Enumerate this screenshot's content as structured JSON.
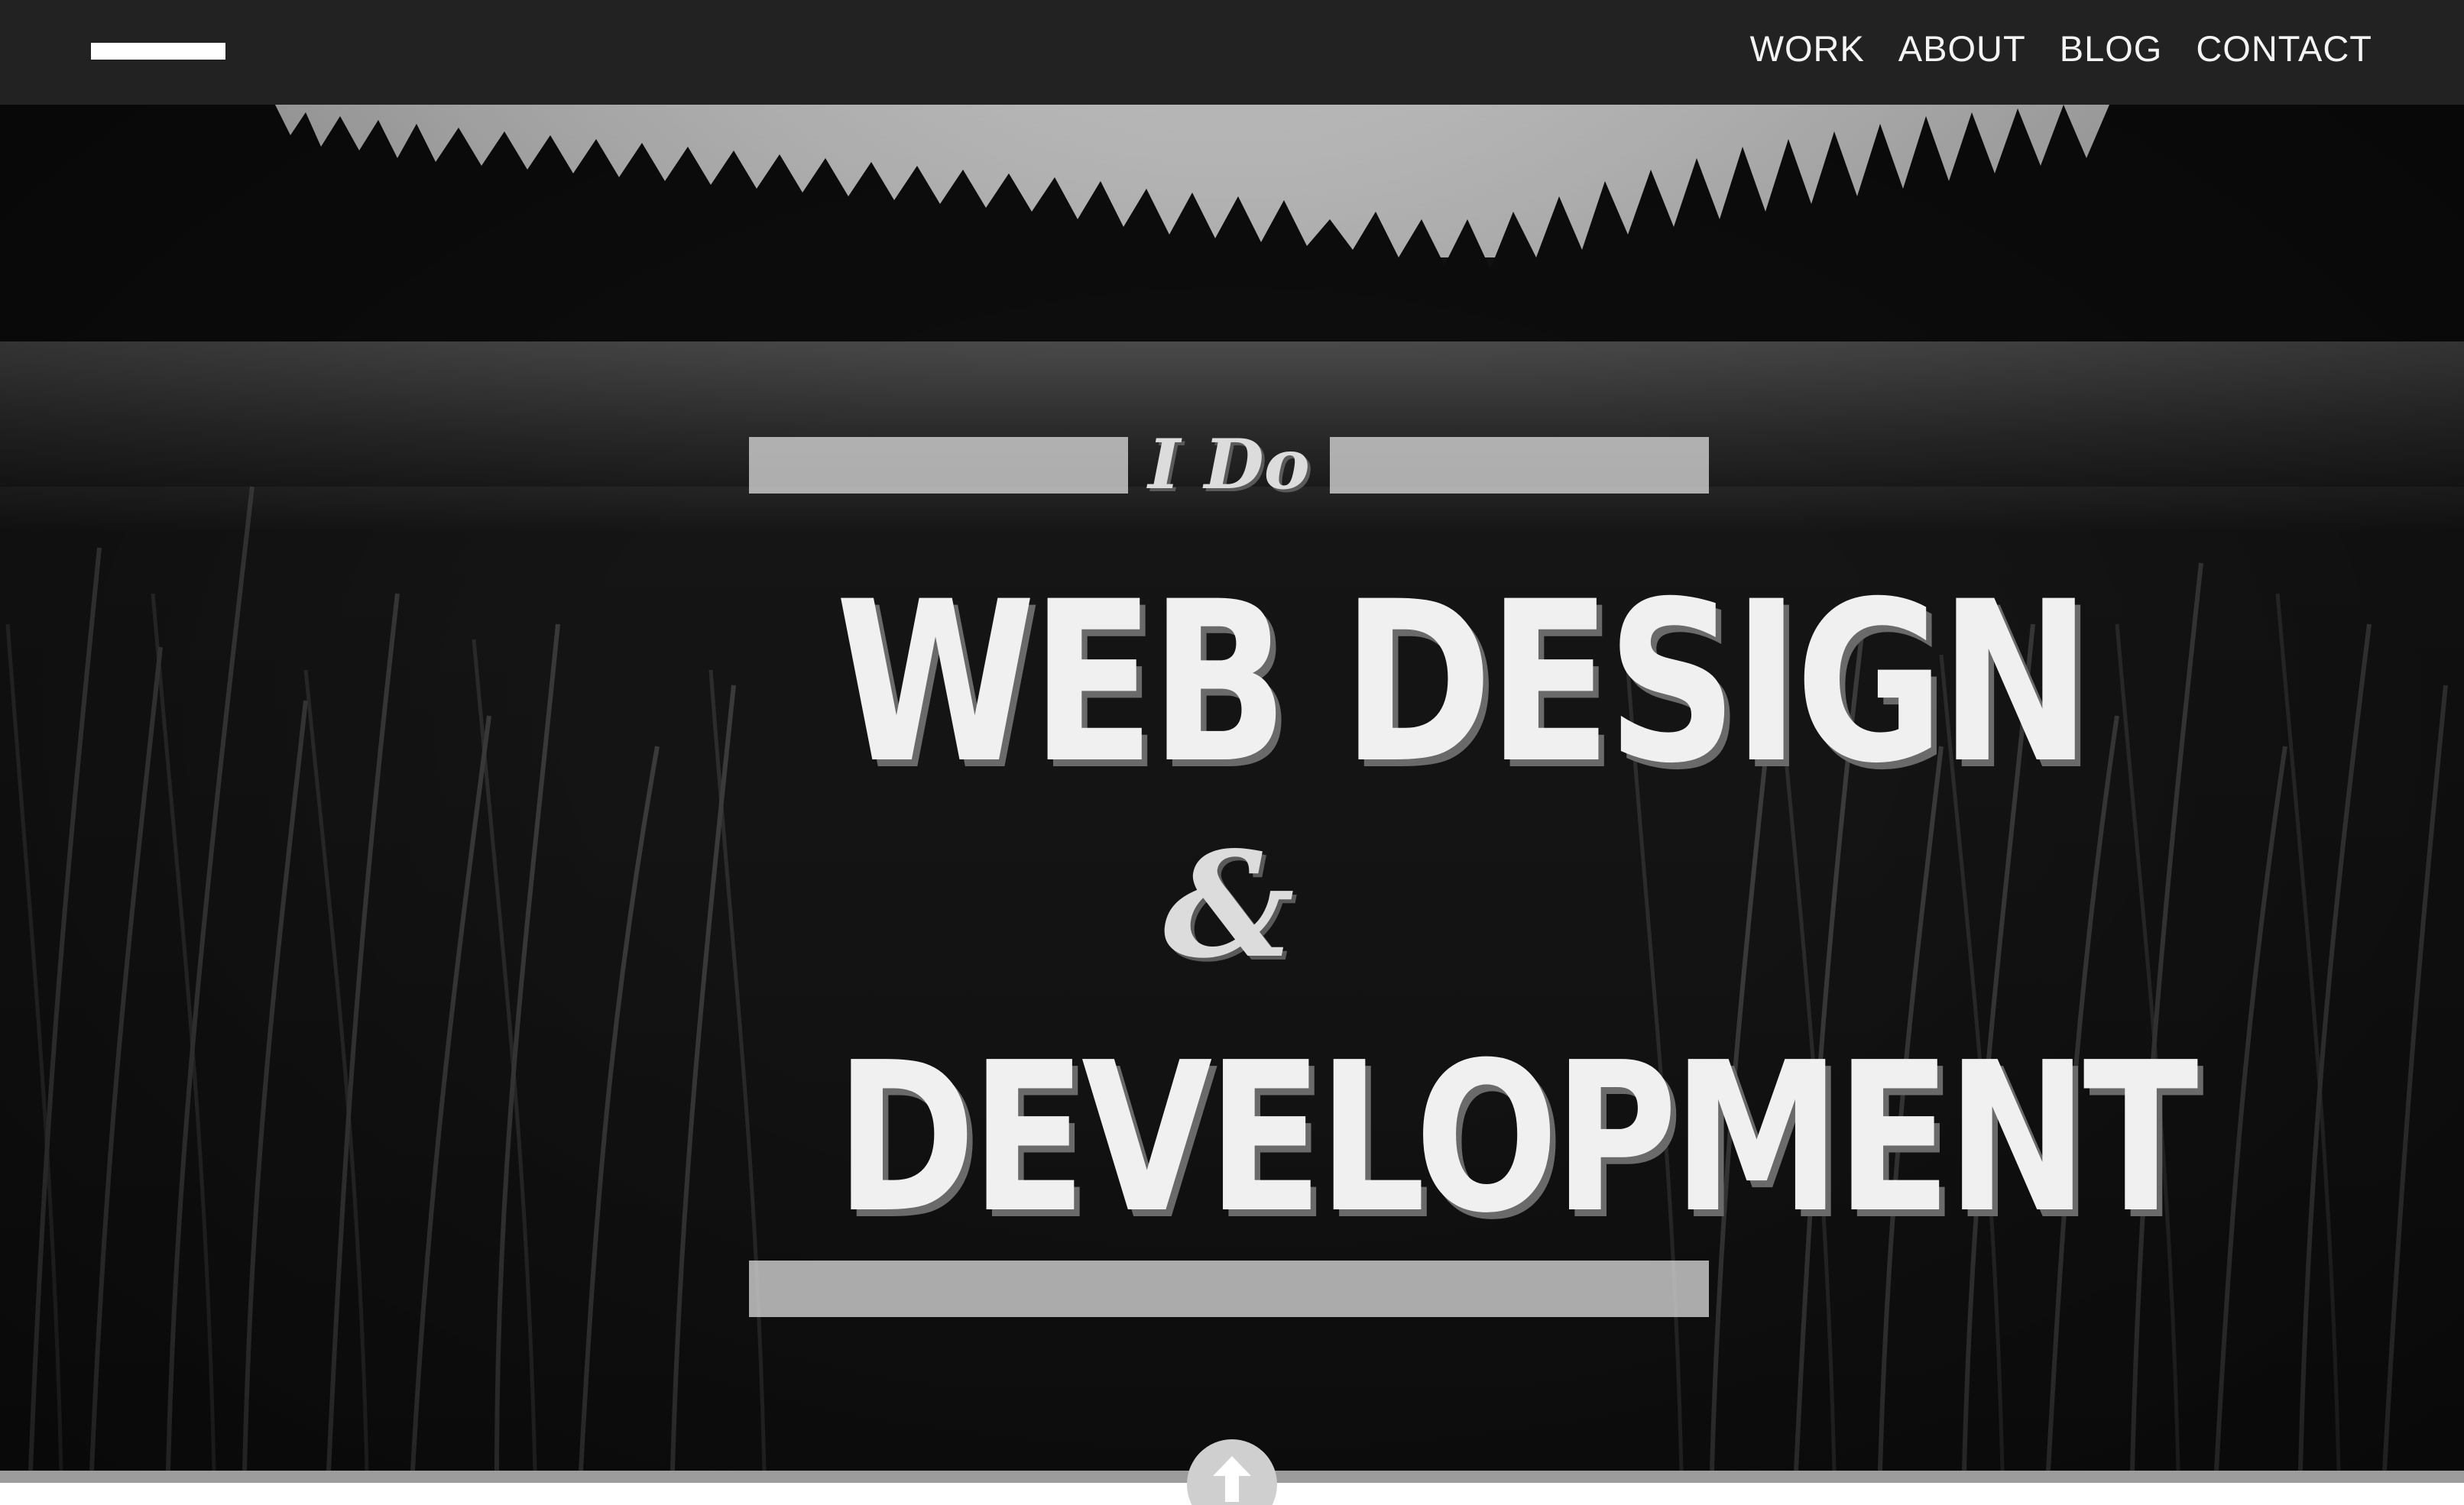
{
  "navbar": {
    "logo_icon": "menu-bar-logo",
    "links": [
      {
        "label": "WORK"
      },
      {
        "label": "ABOUT"
      },
      {
        "label": "BLOG"
      },
      {
        "label": "CONTACT"
      }
    ]
  },
  "hero": {
    "intro": "I Do",
    "line1": "WEB DESIGN",
    "ampersand": "&",
    "line2": "DEVELOPMENT",
    "background": "black-and-white grassy meadow with pine forest"
  },
  "scroll_button": {
    "icon": "arrow-up-icon"
  },
  "colors": {
    "navbar": "#222222",
    "nav_text": "#f4f4f4",
    "headline_text": "#f0f0f0",
    "accent_bars": "#d7d7d7",
    "strip": "#9c9c9c"
  }
}
